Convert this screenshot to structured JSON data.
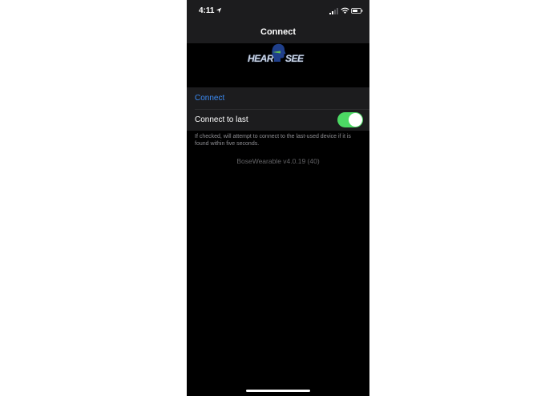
{
  "status_bar": {
    "time": "4:11",
    "icons": [
      "location-arrow-icon",
      "cellular-signal-icon",
      "wifi-icon",
      "battery-icon"
    ]
  },
  "nav": {
    "title": "Connect"
  },
  "logo": {
    "left_text": "HEAR",
    "right_text": "SEE"
  },
  "settings": {
    "connect_label": "Connect",
    "connect_to_last_label": "Connect to last",
    "connect_to_last_enabled": true,
    "footnote": "If checked, will attempt to connect to the last-used device if it is found within five seconds."
  },
  "version": "BoseWearable v4.0.19 (40)",
  "colors": {
    "background": "#000000",
    "bar": "#1c1c1e",
    "link": "#3b8bf5",
    "toggle_on": "#4cd964"
  }
}
